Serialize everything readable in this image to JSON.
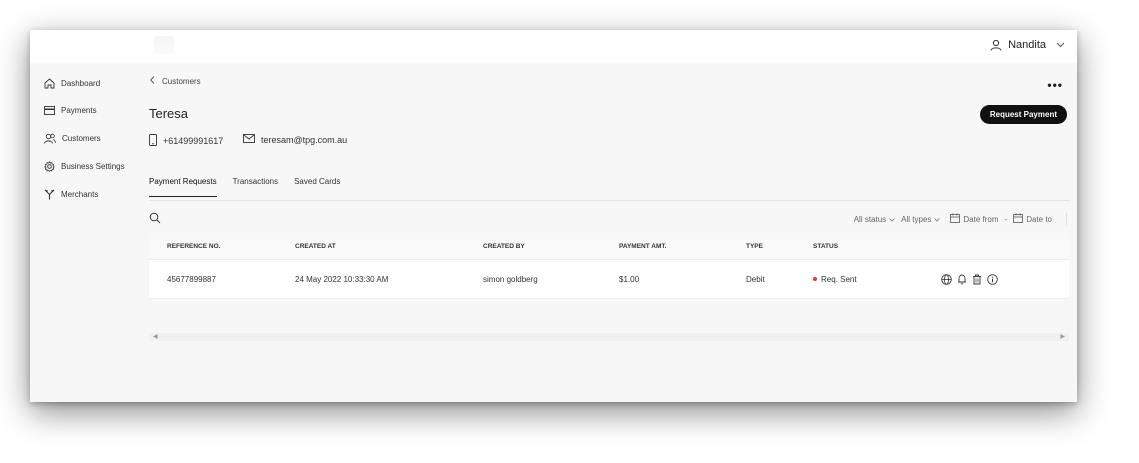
{
  "header": {
    "user_name": "Nandita"
  },
  "sidebar": {
    "items": [
      {
        "label": "Dashboard",
        "icon": "home-icon"
      },
      {
        "label": "Payments",
        "icon": "card-icon"
      },
      {
        "label": "Customers",
        "icon": "users-icon"
      },
      {
        "label": "Business Settings",
        "icon": "gear-icon"
      },
      {
        "label": "Merchants",
        "icon": "merchant-icon"
      }
    ]
  },
  "breadcrumb": {
    "back_label": "Customers"
  },
  "customer": {
    "name": "Teresa",
    "phone": "+61499991617",
    "email": "teresam@tpg.com.au"
  },
  "actions": {
    "request_payment_label": "Request Payment"
  },
  "tabs": [
    {
      "label": "Payment Requests",
      "active": true
    },
    {
      "label": "Transactions",
      "active": false
    },
    {
      "label": "Saved Cards",
      "active": false
    }
  ],
  "filters": {
    "status": "All status",
    "types": "All types",
    "date_from": "Date from",
    "separator": "-",
    "date_to": "Date to"
  },
  "table": {
    "columns": [
      "REFERENCE NO.",
      "CREATED AT",
      "CREATED BY",
      "PAYMENT AMT.",
      "TYPE",
      "STATUS"
    ],
    "rows": [
      {
        "reference": "45677899887",
        "created_at": "24 May 2022 10:33:30 AM",
        "created_by": "simon goldberg",
        "amount": "$1.00",
        "type": "Debit",
        "status": "Req. Sent"
      }
    ]
  },
  "colors": {
    "status_dot": "#e53935",
    "button_bg": "#111111",
    "app_bg": "#f7f7f7"
  }
}
